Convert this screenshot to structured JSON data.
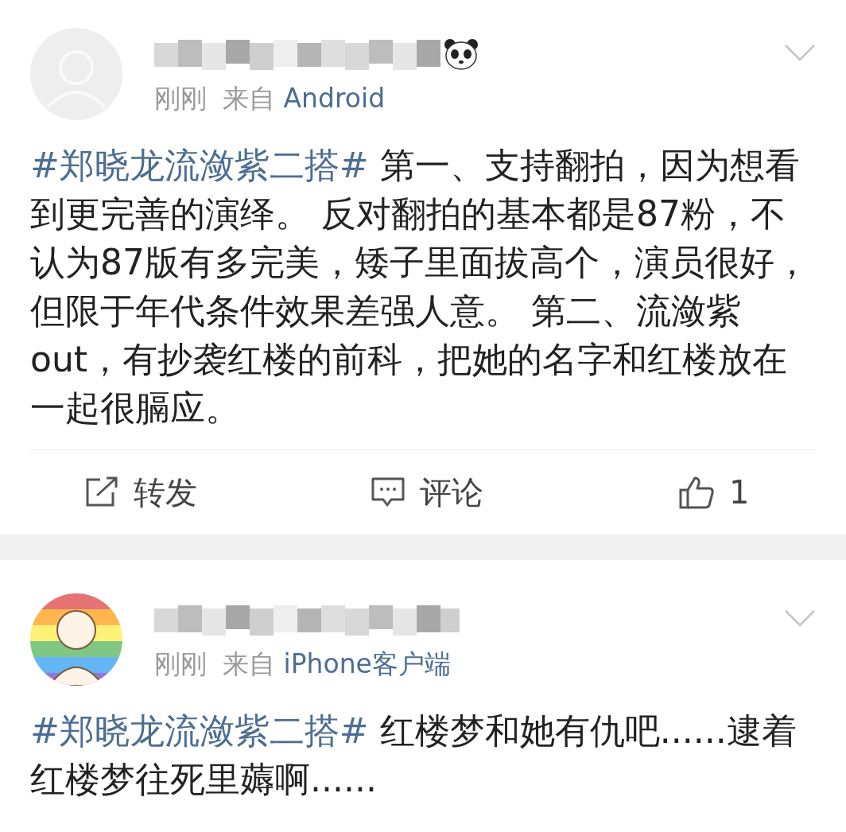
{
  "posts": [
    {
      "avatar": {
        "kind": "blank"
      },
      "name_emoji": true,
      "time": "刚刚",
      "from": "来自",
      "source": "Android",
      "hashtag": "#郑晓龙流潋紫二搭#",
      "text": "第一、支持翻拍，因为想看到更完善的演绎。 反对翻拍的基本都是87粉，不认为87版有多完美，矮子里面拔高个，演员很好，但限于年代条件效果差强人意。 第二、流潋紫out，有抄袭红楼的前科，把她的名字和红楼放在一起很膈应。",
      "actions": {
        "repost": "转发",
        "comment": "评论",
        "likes": "1"
      }
    },
    {
      "name_emoji": false,
      "time": "刚刚",
      "from": "来自",
      "source": "iPhone客户端",
      "hashtag": "#郑晓龙流潋紫二搭#",
      "text": "红楼梦和她有仇吧......逮着红楼梦往死里薅啊......"
    }
  ]
}
